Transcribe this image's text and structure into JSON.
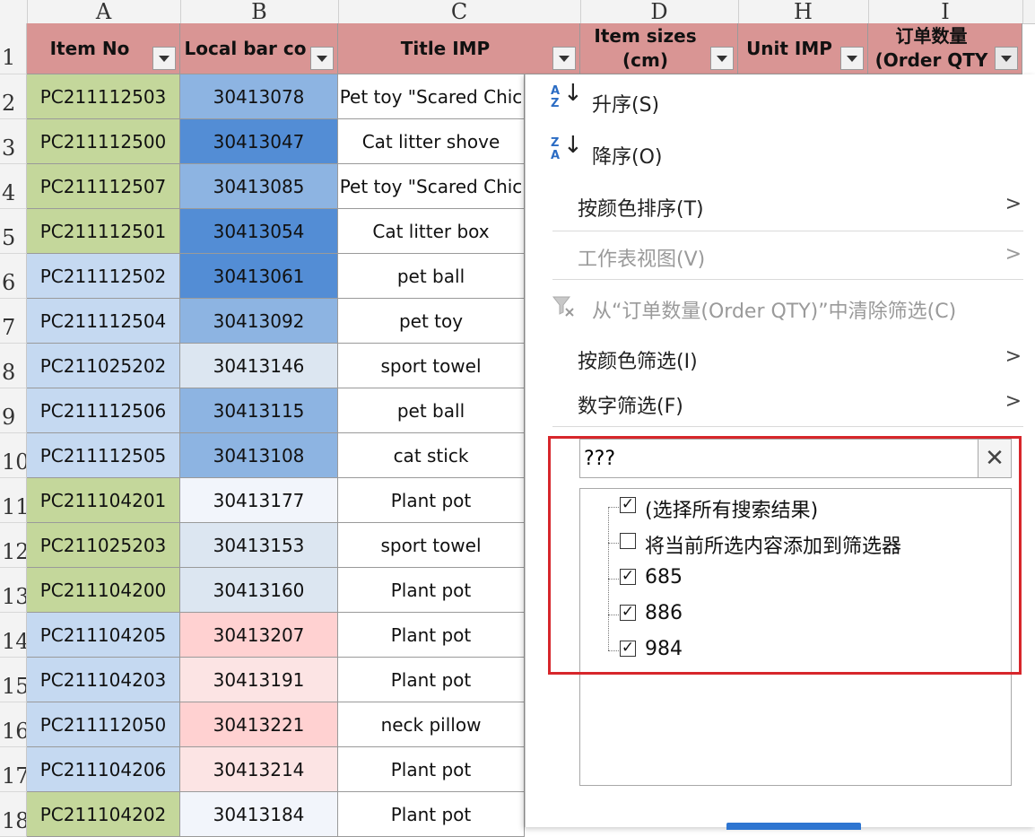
{
  "columns": [
    "A",
    "B",
    "C",
    "D",
    "H",
    "I"
  ],
  "row_numbers": [
    "1",
    "2",
    "3",
    "4",
    "5",
    "6",
    "7",
    "8",
    "9",
    "10",
    "11",
    "12",
    "13",
    "14",
    "15",
    "16",
    "17",
    "18"
  ],
  "headers": {
    "item_no": "Item No",
    "local_bar": "Local bar co",
    "title": "Title IMP",
    "item_sizes_line1": "Item sizes",
    "item_sizes_line2": "(cm)",
    "unit": "Unit IMP",
    "order_qty_line1": "订单数量",
    "order_qty_line2": "(Order QTY"
  },
  "rows": [
    {
      "item": "PC211112503",
      "bar": "30413078",
      "title": "Pet toy \"Scared Chic"
    },
    {
      "item": "PC211112500",
      "bar": "30413047",
      "title": "Cat litter shove"
    },
    {
      "item": "PC211112507",
      "bar": "30413085",
      "title": "Pet toy \"Scared Chic"
    },
    {
      "item": "PC211112501",
      "bar": "30413054",
      "title": "Cat litter box"
    },
    {
      "item": "PC211112502",
      "bar": "30413061",
      "title": "pet ball"
    },
    {
      "item": "PC211112504",
      "bar": "30413092",
      "title": "pet toy"
    },
    {
      "item": "PC211025202",
      "bar": "30413146",
      "title": "sport towel"
    },
    {
      "item": "PC211112506",
      "bar": "30413115",
      "title": "pet ball"
    },
    {
      "item": "PC211112505",
      "bar": "30413108",
      "title": "cat stick"
    },
    {
      "item": "PC211104201",
      "bar": "30413177",
      "title": "Plant pot"
    },
    {
      "item": "PC211025203",
      "bar": "30413153",
      "title": "sport towel"
    },
    {
      "item": "PC211104200",
      "bar": "30413160",
      "title": "Plant pot"
    },
    {
      "item": "PC211104205",
      "bar": "30413207",
      "title": "Plant pot"
    },
    {
      "item": "PC211104203",
      "bar": "30413191",
      "title": "Plant pot"
    },
    {
      "item": "PC211112050",
      "bar": "30413221",
      "title": "neck pillow"
    },
    {
      "item": "PC211104206",
      "bar": "30413214",
      "title": "Plant pot"
    },
    {
      "item": "PC211104202",
      "bar": "30413184",
      "title": "Plant pot"
    }
  ],
  "colors": {
    "header_bg": "#d99594",
    "item_green": "#c4d79b",
    "item_blue": "#c5d9f1",
    "bar_dark_blue": "#538dd5",
    "bar_mid_blue": "#8db4e2",
    "bar_light_blue": "#dce6f1",
    "bar_pale": "#f2f5fb",
    "bar_pink": "#ffd1d1",
    "bar_light_pink": "#fce4e4",
    "highlight_red": "#d7262b"
  },
  "menu": {
    "sort_asc": "升序(S)",
    "sort_desc": "降序(O)",
    "sort_by_color": "按颜色排序(T)",
    "sheet_view": "工作表视图(V)",
    "clear_filter": "从“订单数量(Order QTY)”中清除筛选(C)",
    "filter_by_color": "按颜色筛选(I)",
    "number_filter": "数字筛选(F)",
    "search_value": "???",
    "list_items": [
      {
        "label": "(选择所有搜索结果)",
        "checked": true
      },
      {
        "label": "将当前所选内容添加到筛选器",
        "checked": false
      },
      {
        "label": "685",
        "checked": true
      },
      {
        "label": "886",
        "checked": true
      },
      {
        "label": "984",
        "checked": true
      }
    ]
  },
  "icons": {
    "sort_asc": "sort-ascending-icon",
    "sort_desc": "sort-descending-icon",
    "chevron": "chevron-right-icon",
    "clear_filter": "clear-filter-icon",
    "clear_search": "close-icon",
    "dropdown": "dropdown-arrow-icon"
  }
}
